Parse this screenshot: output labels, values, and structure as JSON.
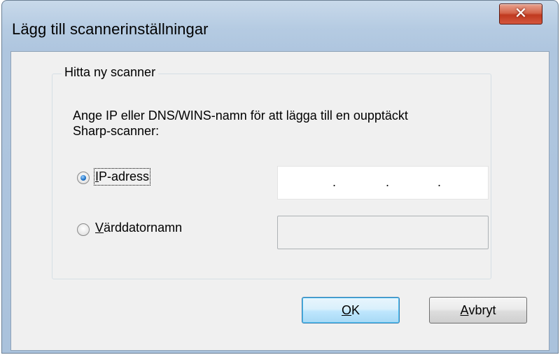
{
  "window": {
    "title": "Lägg till scannerinställningar",
    "close_icon": "close-icon",
    "close_glyph": "✕"
  },
  "group": {
    "label": "Hitta ny scanner",
    "description": "Ange IP eller DNS/WINS-namn för att lägga till en oupptäckt Sharp-scanner:"
  },
  "options": [
    {
      "label_first": "I",
      "label_rest": "P-adress",
      "selected": true
    },
    {
      "label_first": "V",
      "label_rest": "ärddatornamn",
      "selected": false
    }
  ],
  "ip_field": {
    "separator": "."
  },
  "buttons": {
    "ok_first": "O",
    "ok_rest": "K",
    "cancel_first": "A",
    "cancel_rest": "vbryt"
  },
  "colors": {
    "title_gradient_top": "#c8d9ea",
    "close_button": "#c0391f",
    "default_button_border": "#3c7fb1",
    "radio_selected": "#1b6fc5"
  }
}
